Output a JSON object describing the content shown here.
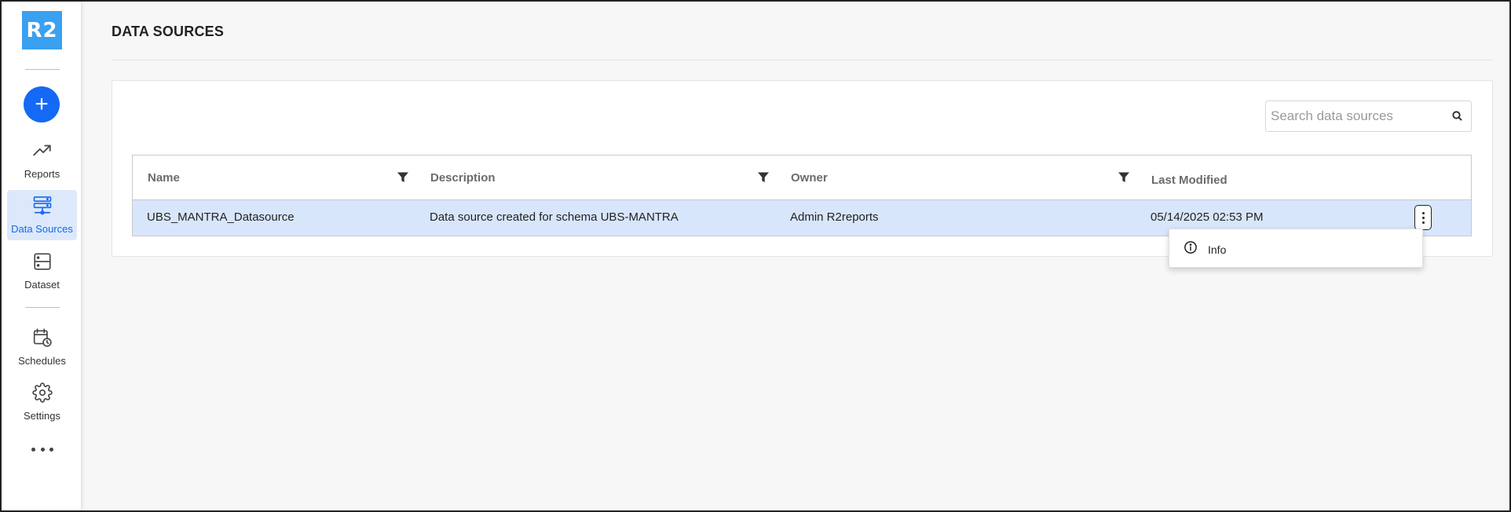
{
  "app": {
    "logo_text": "R2",
    "accent_color": "#1469f5",
    "logo_color": "#3aa0f0"
  },
  "sidebar": {
    "create_label": "+",
    "items": [
      {
        "label": "Reports",
        "icon": "trending-up-icon"
      },
      {
        "label": "Data Sources",
        "icon": "data-sources-icon",
        "active": true
      },
      {
        "label": "Dataset",
        "icon": "dataset-icon"
      },
      {
        "label": "Schedules",
        "icon": "calendar-clock-icon"
      },
      {
        "label": "Settings",
        "icon": "gear-icon"
      }
    ],
    "more_icon": "more-horizontal-icon"
  },
  "page": {
    "title": "DATA SOURCES"
  },
  "search": {
    "placeholder": "Search data sources",
    "value": ""
  },
  "table": {
    "columns": [
      "Name",
      "Description",
      "Owner",
      "Last Modified"
    ],
    "rows": [
      {
        "name": "UBS_MANTRA_Datasource",
        "description": "Data source created for schema UBS-MANTRA",
        "owner": "Admin R2reports",
        "last_modified": "05/14/2025 02:53 PM",
        "selected": true
      }
    ]
  },
  "context_menu": {
    "items": [
      {
        "label": "Info",
        "icon": "info-icon"
      }
    ]
  }
}
